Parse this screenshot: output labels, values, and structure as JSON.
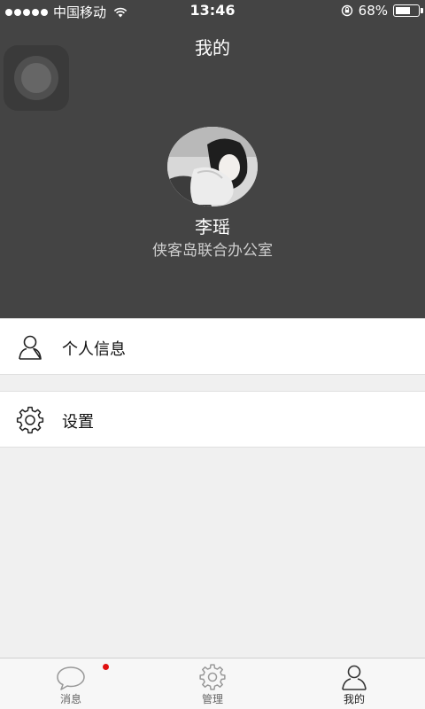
{
  "status_bar": {
    "carrier": "中国移动",
    "time": "13:46",
    "battery_percent_text": "68%",
    "battery_level": 0.68,
    "signal_bars": 5
  },
  "header": {
    "title": "我的"
  },
  "profile": {
    "name": "李瑶",
    "organization": "侠客岛联合办公室"
  },
  "menu": [
    {
      "label": "个人信息",
      "icon": "user-icon"
    },
    {
      "label": "设置",
      "icon": "gear-icon"
    }
  ],
  "tab_bar": {
    "tabs": [
      {
        "label": "消息",
        "icon": "chat-bubble-icon",
        "has_badge": true
      },
      {
        "label": "管理",
        "icon": "gear-icon",
        "has_badge": false
      },
      {
        "label": "我的",
        "icon": "user-icon",
        "active": true
      }
    ]
  },
  "colors": {
    "header_bg": "#444444",
    "badge": "#e01010"
  }
}
